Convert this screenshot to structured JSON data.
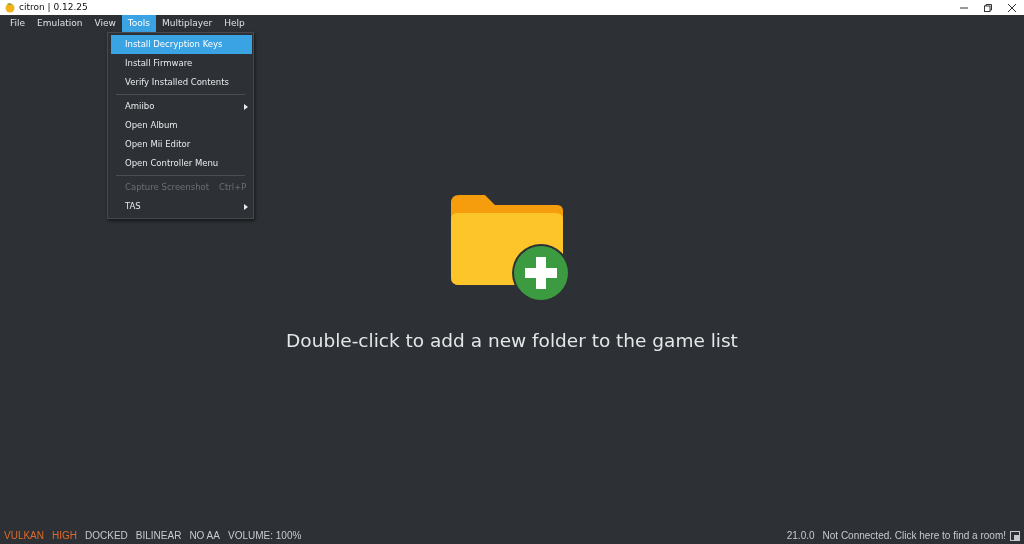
{
  "window": {
    "title": "citron | 0.12.25"
  },
  "menu_bar": [
    {
      "label": "File",
      "selected": false
    },
    {
      "label": "Emulation",
      "selected": false
    },
    {
      "label": "View",
      "selected": false
    },
    {
      "label": "Tools",
      "selected": true
    },
    {
      "label": "Multiplayer",
      "selected": false
    },
    {
      "label": "Help",
      "selected": false
    }
  ],
  "dropdown": [
    {
      "kind": "item",
      "label": "Install Decryption Keys",
      "selected": true,
      "disabled": false
    },
    {
      "kind": "item",
      "label": "Install Firmware",
      "selected": false,
      "disabled": false
    },
    {
      "kind": "item",
      "label": "Verify Installed Contents",
      "selected": false,
      "disabled": false
    },
    {
      "kind": "separator"
    },
    {
      "kind": "submenu",
      "label": "Amiibo",
      "selected": false,
      "disabled": false
    },
    {
      "kind": "item",
      "label": "Open Album",
      "selected": false,
      "disabled": false
    },
    {
      "kind": "item",
      "label": "Open Mii Editor",
      "selected": false,
      "disabled": false
    },
    {
      "kind": "item",
      "label": "Open Controller Menu",
      "selected": false,
      "disabled": false
    },
    {
      "kind": "separator"
    },
    {
      "kind": "item",
      "label": "Capture Screenshot",
      "shortcut": "Ctrl+P",
      "selected": false,
      "disabled": true
    },
    {
      "kind": "submenu",
      "label": "TAS",
      "selected": false,
      "disabled": false
    }
  ],
  "empty_state": {
    "message": "Double-click to add a new folder to the game list"
  },
  "status_bar": {
    "items": [
      {
        "label": "VULKAN",
        "color": "#e06a2a"
      },
      {
        "label": "HIGH",
        "color": "#e06a2a"
      },
      {
        "label": "DOCKED",
        "color": "#c8cbce"
      },
      {
        "label": "BILINEAR",
        "color": "#c8cbce"
      },
      {
        "label": "NO AA",
        "color": "#c8cbce"
      },
      {
        "label": "VOLUME: 100%",
        "color": "#c8cbce"
      }
    ],
    "version": "21.0.0",
    "network": "Not Connected. Click here to find a room!"
  }
}
